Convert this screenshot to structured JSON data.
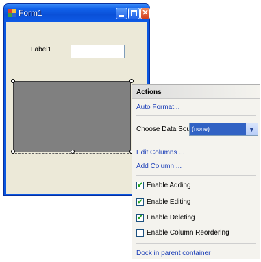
{
  "form": {
    "title": "Form1",
    "label": "Label1",
    "textbox_value": ""
  },
  "smart_tag_glyph": "▸",
  "actions": {
    "header": "Actions",
    "auto_format": "Auto Format...",
    "choose_data_source_label": "Choose Data Source",
    "data_source_value": "(none)",
    "edit_columns": "Edit Columns ...",
    "add_column": "Add Column ...",
    "checks": [
      {
        "label": "Enable Adding",
        "checked": true
      },
      {
        "label": "Enable Editing",
        "checked": true
      },
      {
        "label": "Enable Deleting",
        "checked": true
      },
      {
        "label": "Enable Column Reordering",
        "checked": false
      }
    ],
    "dock": "Dock in parent container"
  },
  "colors": {
    "title_bar": "#0a56e0",
    "form_bg": "#ece9d8",
    "grid_bg": "#808080",
    "link": "#1c3fb8",
    "selection": "#3162c4"
  }
}
